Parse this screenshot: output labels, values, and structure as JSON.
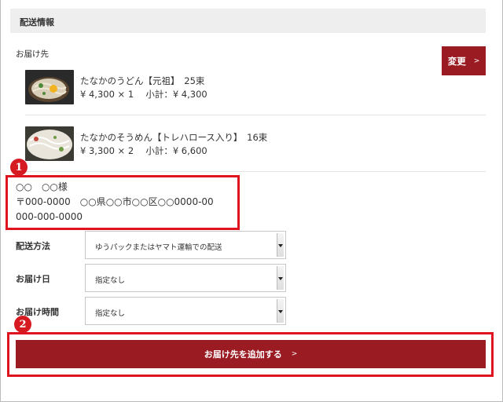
{
  "section": {
    "title": "配送情報"
  },
  "delivery": {
    "label": "お届け先",
    "change_button": "変更",
    "change_chevron": ">"
  },
  "products": [
    {
      "name": "たなかのうどん【元祖】　25束",
      "price_line": "¥ 4,300 × 1　 小計：¥ 4,300",
      "thumb": "udon-photo"
    },
    {
      "name": "たなかのそうめん【トレハロース入り】　16束",
      "price_line": "¥ 3,300 × 2　 小計：¥ 6,600",
      "thumb": "somen-photo"
    }
  ],
  "address": {
    "name": "○○　○○様",
    "line": "〒000-0000　○○県○○市○○区○○0000-00",
    "phone": "000-000-0000"
  },
  "form": {
    "method_label": "配送方法",
    "method_value": "ゆうパックまたはヤマト運輸での配送",
    "date_label": "お届け日",
    "date_value": "指定なし",
    "time_label": "お届け時間",
    "time_value": "指定なし"
  },
  "add_button": {
    "label": "お届け先を追加する",
    "chevron": ">"
  },
  "annotations": {
    "badge1": "1",
    "badge2": "2"
  },
  "colors": {
    "accent": "#9a1b22",
    "highlight": "#e0141e"
  }
}
